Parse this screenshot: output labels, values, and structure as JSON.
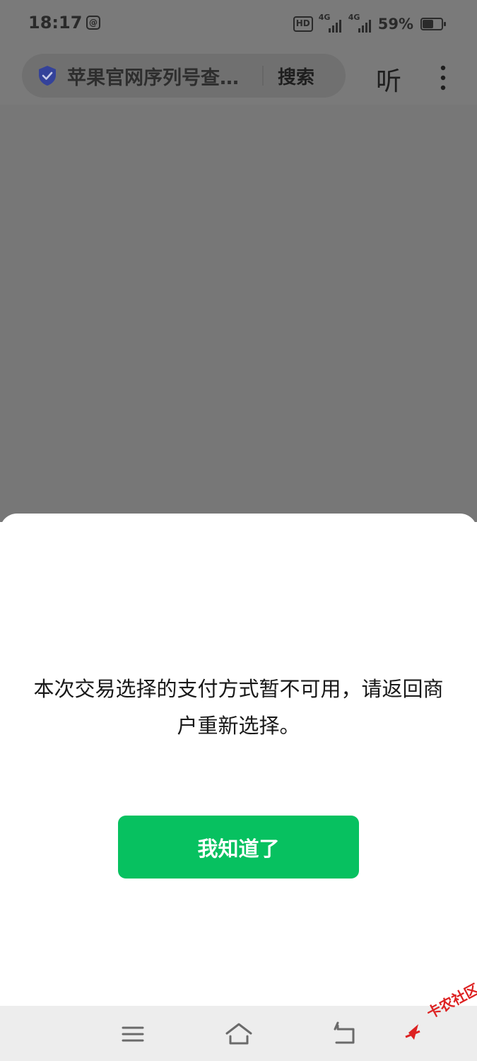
{
  "status_bar": {
    "time": "18:17",
    "at_icon": "@",
    "hd_label": "HD",
    "network_1": "4G",
    "network_2": "4G",
    "battery_percent": "59%",
    "battery_level": 0.59
  },
  "browser": {
    "address_text": "苹果官网序列号查…",
    "search_label": "搜索",
    "listen_label": "听",
    "shield_color": "#3344aa"
  },
  "dialog": {
    "message": "本次交易选择的支付方式暂不可用，请返回商户重新选择。",
    "confirm_label": "我知道了",
    "confirm_color": "#07c160"
  },
  "nav": {
    "menu_icon": "menu-icon",
    "home_icon": "home-icon",
    "back_icon": "back-icon"
  },
  "watermark": {
    "text": "卡农社区"
  }
}
